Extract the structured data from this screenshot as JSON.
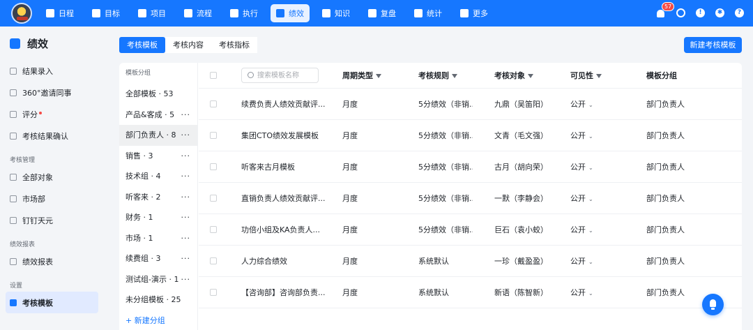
{
  "nav": {
    "items": [
      {
        "label": "日程",
        "icon": "calendar-icon"
      },
      {
        "label": "目标",
        "icon": "target-icon"
      },
      {
        "label": "项目",
        "icon": "cube-icon"
      },
      {
        "label": "流程",
        "icon": "flow-icon"
      },
      {
        "label": "执行",
        "icon": "checklist-icon"
      },
      {
        "label": "绩效",
        "icon": "performance-icon"
      },
      {
        "label": "知识",
        "icon": "book-icon"
      },
      {
        "label": "复盘",
        "icon": "review-icon"
      },
      {
        "label": "统计",
        "icon": "pie-chart-icon"
      },
      {
        "label": "更多",
        "icon": "grid-icon"
      }
    ],
    "active_index": 5,
    "notification_count": "57"
  },
  "sidebar": {
    "title": "绩效",
    "items": [
      {
        "label": "结果录入",
        "icon": "pen-icon"
      },
      {
        "label": "360°邀请同事",
        "icon": "people-icon"
      },
      {
        "label": "评分",
        "icon": "score-icon",
        "red_dot": true
      },
      {
        "label": "考核结果确认",
        "icon": "bookmark-icon"
      }
    ],
    "section_manage": "考核管理",
    "manage_items": [
      {
        "label": "全部对象",
        "icon": "grid-dots-icon"
      },
      {
        "label": "市场部",
        "icon": "shield-icon"
      },
      {
        "label": "钉钉天元",
        "icon": "shield-icon"
      }
    ],
    "section_report": "绩效报表",
    "report_items": [
      {
        "label": "绩效报表",
        "icon": "report-icon"
      }
    ],
    "section_settings": "设置",
    "settings_items": [
      {
        "label": "考核模板",
        "icon": "template-icon",
        "active": true
      }
    ]
  },
  "tabs": [
    "考核模板",
    "考核内容",
    "考核指标"
  ],
  "new_template_button": "新建考核模板",
  "groups": {
    "header": "模板分组",
    "items": [
      {
        "label": "全部模板 · 53",
        "more": false
      },
      {
        "label": "产品&客成 · 5",
        "more": true
      },
      {
        "label": "部门负责人 · 8",
        "more": true,
        "active": true
      },
      {
        "label": "销售 · 3",
        "more": true
      },
      {
        "label": "技术组 · 4",
        "more": true
      },
      {
        "label": "听客来 · 2",
        "more": true
      },
      {
        "label": "财务 · 1",
        "more": true
      },
      {
        "label": "市场 · 1",
        "more": true
      },
      {
        "label": "续费组 · 3",
        "more": true
      },
      {
        "label": "测试组-演示 · 1",
        "more": true
      },
      {
        "label": "未分组模板 · 25",
        "more": false
      }
    ],
    "add_label": "+ 新建分组"
  },
  "table": {
    "search_placeholder": "搜索模板名称",
    "columns": [
      "周期类型",
      "考核规则",
      "考核对象",
      "可见性",
      "模板分组"
    ],
    "rows": [
      {
        "name": "续费负责人绩效贡献评...",
        "period": "月度",
        "rule": "5分绩效（非销...",
        "target": "九鼎（吴笛阳）",
        "visibility": "公开",
        "group": "部门负责人"
      },
      {
        "name": "集团CTO绩效发展模板",
        "period": "月度",
        "rule": "5分绩效（非销...",
        "target": "文青（毛文强）",
        "visibility": "公开",
        "group": "部门负责人"
      },
      {
        "name": "听客来古月模板",
        "period": "月度",
        "rule": "5分绩效（非销...",
        "target": "古月（胡向荣）",
        "visibility": "公开",
        "group": "部门负责人"
      },
      {
        "name": "直销负责人绩效贡献评...",
        "period": "月度",
        "rule": "5分绩效（非销...",
        "target": "一默（李静会）",
        "visibility": "公开",
        "group": "部门负责人"
      },
      {
        "name": "功倍小组及KA负责人...",
        "period": "月度",
        "rule": "5分绩效（非销...",
        "target": "巨石（袁小蛟）",
        "visibility": "公开",
        "group": "部门负责人"
      },
      {
        "name": "人力综合绩效",
        "period": "月度",
        "rule": "系统默认",
        "target": "一珍（戴盈盈）",
        "visibility": "公开",
        "group": "部门负责人"
      },
      {
        "name": "【咨询部】咨询部负责...",
        "period": "月度",
        "rule": "系统默认",
        "target": "新语（陈智新）",
        "visibility": "公开",
        "group": "部门负责人"
      }
    ]
  },
  "colors": {
    "primary": "#1677ff",
    "background": "#f3f5f8",
    "active_nav_bg": "#e8f1ff",
    "danger": "#f54a45"
  }
}
